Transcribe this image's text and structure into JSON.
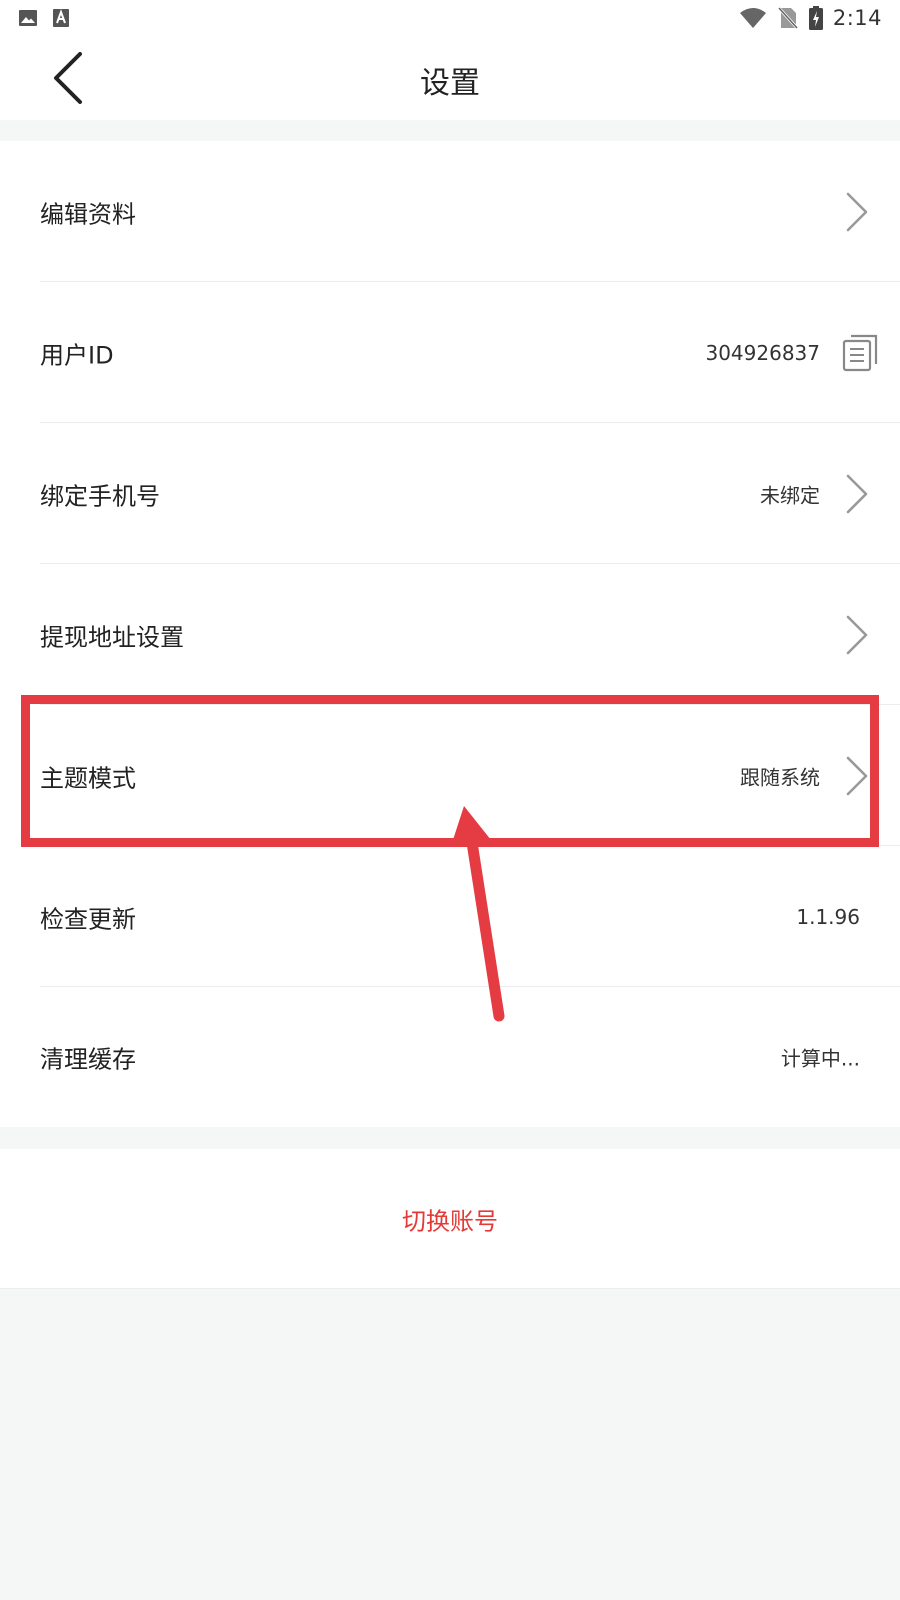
{
  "status_bar": {
    "time": "2:14",
    "icons_left": [
      "image-icon",
      "text-a-icon"
    ],
    "icons_right": [
      "wifi-icon",
      "no-sim-icon",
      "battery-charging-icon"
    ]
  },
  "header": {
    "title": "设置",
    "back_icon": "chevron-left-icon"
  },
  "settings": {
    "items": [
      {
        "label": "编辑资料",
        "value": "",
        "trailing": "chevron"
      },
      {
        "label": "用户ID",
        "value": "304926837",
        "trailing": "copy"
      },
      {
        "label": "绑定手机号",
        "value": "未绑定",
        "trailing": "chevron"
      },
      {
        "label": "提现地址设置",
        "value": "",
        "trailing": "chevron"
      },
      {
        "label": "主题模式",
        "value": "跟随系统",
        "trailing": "chevron"
      },
      {
        "label": "检查更新",
        "value": "1.1.96",
        "trailing": "none"
      },
      {
        "label": "清理缓存",
        "value": "计算中...",
        "trailing": "none"
      }
    ]
  },
  "account": {
    "switch_label": "切换账号"
  },
  "colors": {
    "accent_red": "#e53935",
    "annotation_red": "#e43c42",
    "background": "#f5f6f6",
    "divider": "#ececec"
  }
}
